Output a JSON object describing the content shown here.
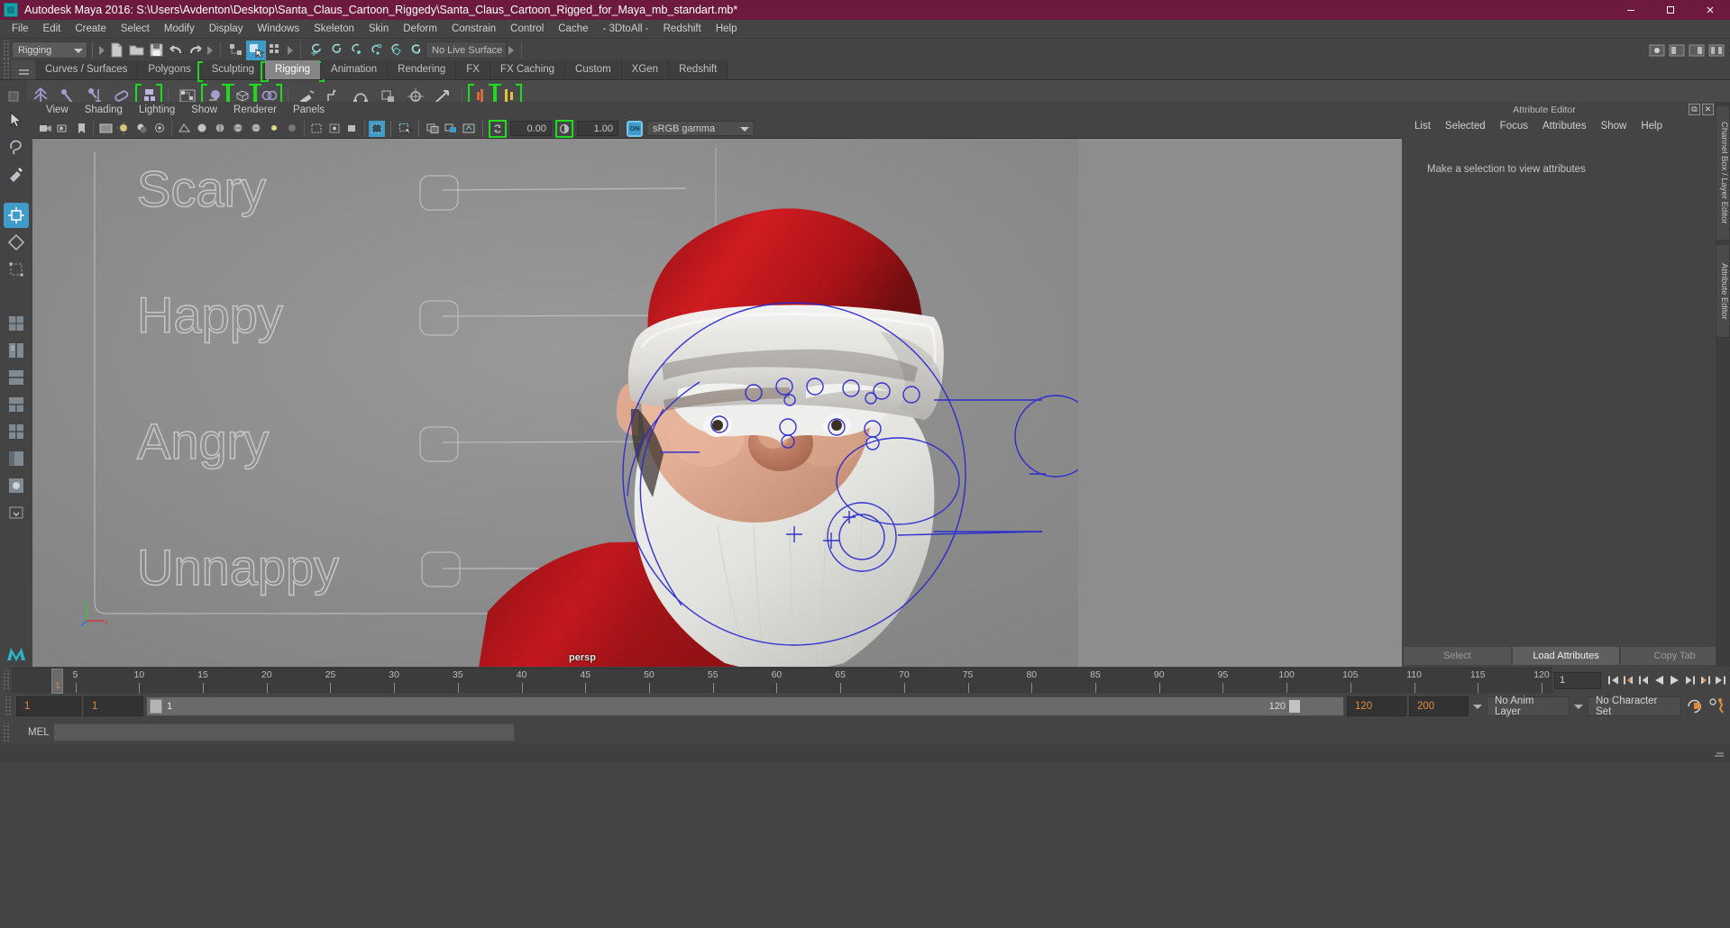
{
  "window": {
    "title": "Autodesk Maya 2016: S:\\Users\\Avdenton\\Desktop\\Santa_Claus_Cartoon_Riggedy\\Santa_Claus_Cartoon_Rigged_for_Maya_mb_standart.mb*",
    "minimize": "–",
    "maximize": "☐",
    "close": "✕",
    "titlebar_color": "#6e1a3e"
  },
  "menubar": {
    "items": [
      "File",
      "Edit",
      "Create",
      "Select",
      "Modify",
      "Display",
      "Windows",
      "Skeleton",
      "Skin",
      "Deform",
      "Constrain",
      "Control",
      "Cache",
      "- 3DtoAll -",
      "Redshift",
      "Help"
    ]
  },
  "status_toolbar": {
    "menu_set": "Rigging",
    "live_surface": "No Live Surface"
  },
  "shelf": {
    "tabs": [
      {
        "label": "Curves / Surfaces",
        "active": false,
        "bracket": false
      },
      {
        "label": "Polygons",
        "active": false,
        "bracket": false
      },
      {
        "label": "Sculpting",
        "active": false,
        "bracket": true
      },
      {
        "label": "Rigging",
        "active": true,
        "bracket": true
      },
      {
        "label": "Animation",
        "active": false,
        "bracket": false
      },
      {
        "label": "Rendering",
        "active": false,
        "bracket": false
      },
      {
        "label": "FX",
        "active": false,
        "bracket": false
      },
      {
        "label": "FX Caching",
        "active": false,
        "bracket": false
      },
      {
        "label": "Custom",
        "active": false,
        "bracket": false
      },
      {
        "label": "XGen",
        "active": false,
        "bracket": false
      },
      {
        "label": "Redshift",
        "active": false,
        "bracket": false
      }
    ]
  },
  "viewport_panel": {
    "menus": [
      "View",
      "Shading",
      "Lighting",
      "Show",
      "Renderer",
      "Panels"
    ],
    "exposure_value": "0.00",
    "gamma_value": "1.00",
    "color_management_toggle": "ON",
    "color_profile": "sRGB gamma",
    "camera_label": "persp",
    "axis_labels": {
      "y": "y",
      "x": "x",
      "z": "z"
    }
  },
  "scene": {
    "control_labels": [
      "Scary",
      "Happy",
      "Angry",
      "Unnappy"
    ],
    "character": "Santa Claus cartoon rigged model",
    "background_color": "#8d8d8d",
    "hat_color": "#c0171b",
    "trim_color": "#e4e2df",
    "skin_color": "#e6b69c",
    "beard_color": "#e8e8e6",
    "nose_color": "#c07b62",
    "curve_color": "#2b2bc8"
  },
  "attribute_editor": {
    "title": "Attribute Editor",
    "menus": [
      "List",
      "Selected",
      "Focus",
      "Attributes",
      "Show",
      "Help"
    ],
    "empty_message": "Make a selection to view attributes",
    "buttons": [
      {
        "label": "Select",
        "primary": false
      },
      {
        "label": "Load Attributes",
        "primary": true
      },
      {
        "label": "Copy Tab",
        "primary": false
      }
    ],
    "window_buttons": {
      "float": "⧉",
      "close": "✕"
    }
  },
  "vertical_tabs": [
    {
      "label": "Channel Box / Layer Editor"
    },
    {
      "label": "Attribute Editor"
    }
  ],
  "timeline": {
    "current_frame": "1",
    "ticks": [
      5,
      10,
      15,
      20,
      25,
      30,
      35,
      40,
      45,
      50,
      55,
      60,
      65,
      70,
      75,
      80,
      85,
      90,
      95,
      100,
      105,
      110,
      115,
      120
    ],
    "start": 1,
    "end": 120,
    "frame_field": "1",
    "transport_icons": [
      "go-to-start-icon",
      "step-back-key-icon",
      "step-back-frame-icon",
      "play-backwards-icon",
      "play-forwards-icon",
      "step-forward-frame-icon",
      "step-forward-key-icon",
      "go-to-end-icon"
    ]
  },
  "range_bar": {
    "range_start": "1",
    "anim_start": "1",
    "slider_label": "1",
    "slider_end_label": "120",
    "anim_end": "120",
    "range_end": "200",
    "anim_layer": "No Anim Layer",
    "character_set": "No Character Set"
  },
  "command_line": {
    "label": "MEL",
    "input_value": ""
  }
}
